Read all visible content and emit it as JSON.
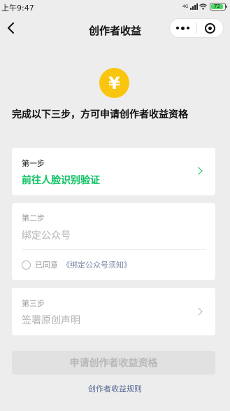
{
  "status_bar": {
    "time": "上午9:47",
    "network": "4G",
    "battery": "72"
  },
  "nav": {
    "title": "创作者收益"
  },
  "header": {
    "coin_symbol": "¥",
    "headline": "完成以下三步，方可申请创作者收益资格"
  },
  "steps": [
    {
      "label": "第一步",
      "title": "前往人脸识别验证",
      "state": "active"
    },
    {
      "label": "第二步",
      "title": "绑定公众号",
      "state": "disabled"
    },
    {
      "label": "第三步",
      "title": "签署原创声明",
      "state": "disabled"
    }
  ],
  "agreement": {
    "prefix": "已同意",
    "link": "《绑定公众号须知》"
  },
  "actions": {
    "apply_button": "申请创作者收益资格",
    "rules_link": "创作者收益规则"
  },
  "colors": {
    "accent_green": "#07c160",
    "coin_yellow": "#fac50f",
    "link_blue": "#576b95",
    "background": "#ededed"
  }
}
